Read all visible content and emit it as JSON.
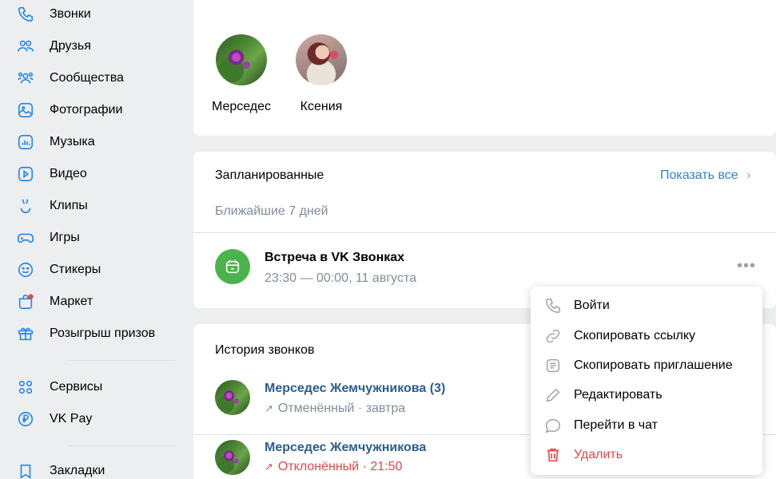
{
  "sidebar": {
    "items": [
      {
        "label": "Звонки",
        "icon": "phone-icon"
      },
      {
        "label": "Друзья",
        "icon": "friends-icon"
      },
      {
        "label": "Сообщества",
        "icon": "communities-icon"
      },
      {
        "label": "Фотографии",
        "icon": "photos-icon"
      },
      {
        "label": "Музыка",
        "icon": "music-icon"
      },
      {
        "label": "Видео",
        "icon": "video-icon"
      },
      {
        "label": "Клипы",
        "icon": "clips-icon"
      },
      {
        "label": "Игры",
        "icon": "games-icon"
      },
      {
        "label": "Стикеры",
        "icon": "stickers-icon"
      },
      {
        "label": "Маркет",
        "icon": "market-icon"
      },
      {
        "label": "Розыгрыш призов",
        "icon": "gift-icon"
      },
      {
        "label": "Сервисы",
        "icon": "services-icon"
      },
      {
        "label": "VK Pay",
        "icon": "vkpay-icon"
      },
      {
        "label": "Закладки",
        "icon": "bookmarks-icon"
      }
    ]
  },
  "friends": [
    {
      "name": "Мерседес"
    },
    {
      "name": "Ксения"
    }
  ],
  "scheduled": {
    "title": "Запланированные",
    "show_all": "Показать все",
    "subtitle": "Ближайшие 7 дней",
    "event": {
      "title": "Встреча в VK Звонках",
      "time": "23:30 — 00:00, 11 августа"
    }
  },
  "history": {
    "title": "История звонков",
    "calls": [
      {
        "name": "Мерседес Жемчужникова (3)",
        "status": "Отменённый · завтра"
      },
      {
        "name": "Мерседес Жемчужникова",
        "status": "Отклонённый · 21:50"
      }
    ]
  },
  "context_menu": {
    "items": [
      {
        "label": "Войти",
        "icon": "phone-icon"
      },
      {
        "label": "Скопировать ссылку",
        "icon": "link-icon"
      },
      {
        "label": "Скопировать приглашение",
        "icon": "document-icon"
      },
      {
        "label": "Редактировать",
        "icon": "pencil-icon"
      },
      {
        "label": "Перейти в чат",
        "icon": "chat-bubble-icon"
      },
      {
        "label": "Удалить",
        "icon": "trash-icon"
      }
    ]
  },
  "colors": {
    "accent": "#2d81e0",
    "icon": "#2688eb",
    "event_green": "#4bb34b",
    "danger": "#e64646"
  }
}
